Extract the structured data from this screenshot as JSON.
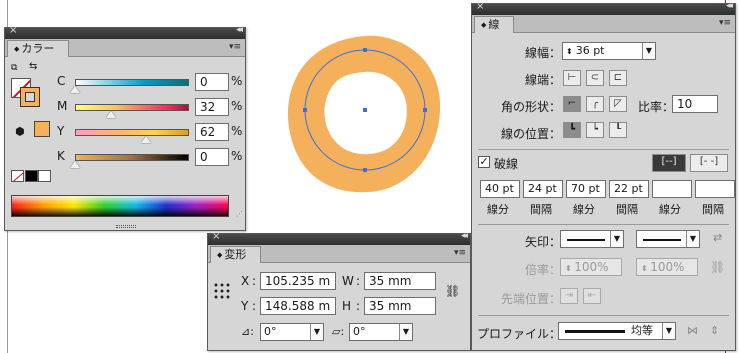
{
  "color_panel": {
    "title": "カラー",
    "channels": [
      {
        "label": "C",
        "value": "0",
        "unit": "%",
        "level": 0
      },
      {
        "label": "M",
        "value": "32",
        "unit": "%",
        "level": 32
      },
      {
        "label": "Y",
        "value": "62",
        "unit": "%",
        "level": 62
      },
      {
        "label": "K",
        "value": "0",
        "unit": "%",
        "level": 0
      }
    ],
    "fill_color": "#f4b05b"
  },
  "canvas": {
    "ring_color": "#f4b05b",
    "path_color": "#3b6fe0"
  },
  "transform_panel": {
    "title": "変形",
    "x_label": "X",
    "x_value": "105.235 m",
    "y_label": "Y",
    "y_value": "148.588 m",
    "w_label": "W",
    "w_value": "35 mm",
    "h_label": "H",
    "h_value": "35 mm",
    "rotate_value": "0°",
    "shear_value": "0°"
  },
  "stroke_panel": {
    "title": "線",
    "weight_label": "線幅：",
    "weight_value": "36 pt",
    "cap_label": "線端：",
    "corner_label": "角の形状：",
    "limit_label": "比率：",
    "limit_value": "10",
    "align_label": "線の位置：",
    "dashed_label": "破線",
    "dash_values": [
      "40 pt",
      "24 pt",
      "70 pt",
      "22 pt",
      "",
      ""
    ],
    "dash_captions": [
      "線分",
      "間隔",
      "線分",
      "間隔",
      "線分",
      "間隔"
    ],
    "arrow_label": "矢印：",
    "scale_label": "倍率：",
    "scale_start": "100%",
    "scale_end": "100%",
    "tip_label": "先端位置：",
    "profile_label": "プロファイル：",
    "profile_value": "均等"
  }
}
